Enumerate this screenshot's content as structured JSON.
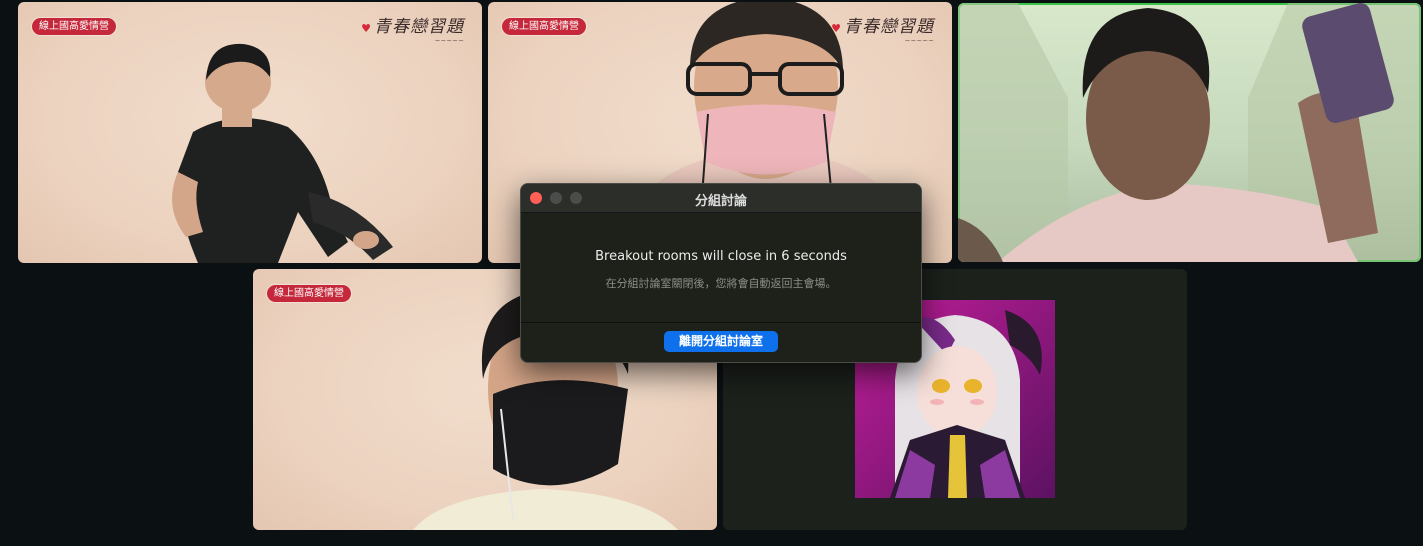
{
  "participants": [
    {
      "id": "p1",
      "tag": "線上國高愛情營",
      "brand": "青春戀習題"
    },
    {
      "id": "p2",
      "tag": "線上國高愛情營",
      "brand": "青春戀習題"
    },
    {
      "id": "p3",
      "speaking": true
    },
    {
      "id": "p4",
      "tag": "線上國高愛情營"
    },
    {
      "id": "p5",
      "avatar": "anime-avatar"
    }
  ],
  "dialog": {
    "title": "分組討論",
    "message": "Breakout rooms will close in 6 seconds",
    "submessage": "在分組討論室關閉後，您將會自動返回主會場。",
    "leave_button": "離開分組討論室"
  },
  "colors": {
    "background": "#0b1013",
    "active_speaker": "#3cc449",
    "primary_button": "#0e71eb",
    "close_dot": "#fe5f57"
  }
}
